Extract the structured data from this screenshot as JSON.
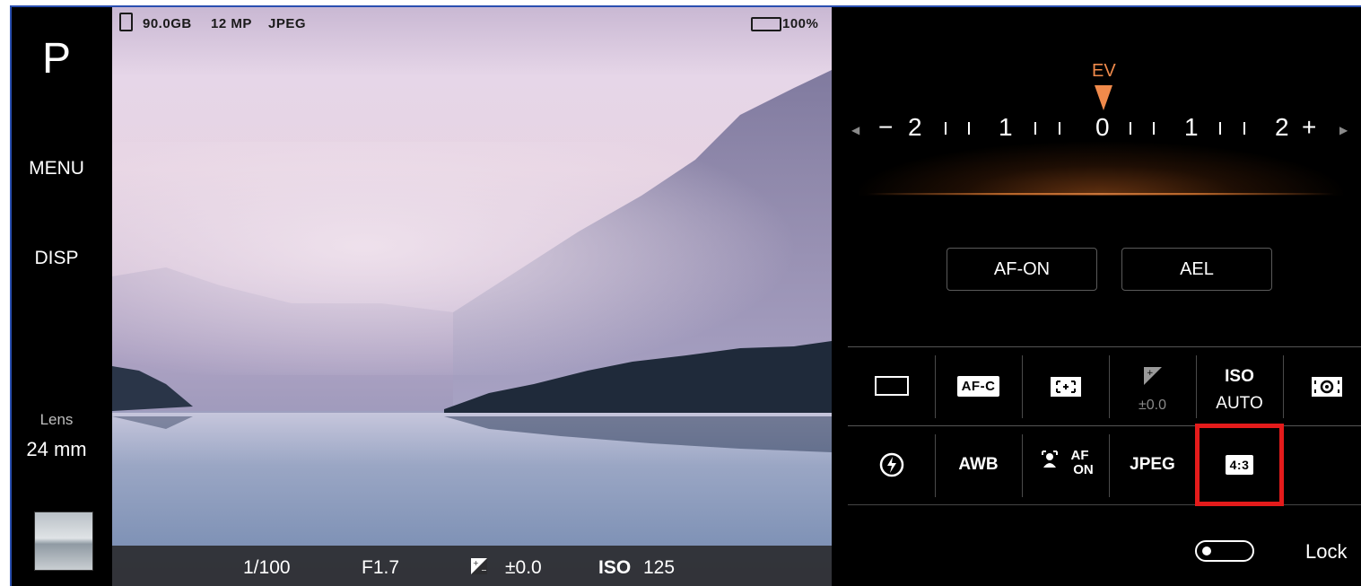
{
  "left_rail": {
    "mode": "P",
    "menu_label": "MENU",
    "disp_label": "DISP",
    "lens_caption": "Lens",
    "lens_value": "24 mm"
  },
  "status": {
    "storage": "90.0GB",
    "megapixels": "12 MP",
    "format": "JPEG",
    "battery": "100%"
  },
  "bottom_bar": {
    "shutter": "1/100",
    "aperture": "F1.7",
    "ev": "±0.0",
    "iso_label": "ISO",
    "iso_value": "125"
  },
  "ev_dial": {
    "label": "EV",
    "minus": "−",
    "plus": "+",
    "scale": [
      "2",
      "1",
      "0",
      "1",
      "2"
    ],
    "current": "0"
  },
  "buttons": {
    "af_on": "AF-ON",
    "ael": "AEL"
  },
  "quick_settings": {
    "row1": {
      "drive_icon": "single-shot-icon",
      "focus_mode": "AF-C",
      "focus_area_icon": "focus-area-icon",
      "ev_value": "±0.0",
      "iso_label": "ISO",
      "iso_value": "AUTO",
      "metering_icon": "metering-icon"
    },
    "row2": {
      "flash_icon": "flash-auto-icon",
      "white_balance": "AWB",
      "face_af_label": "AF",
      "face_af_sub": "ON",
      "file_format": "JPEG",
      "aspect_ratio": "4:3"
    }
  },
  "lock": {
    "label": "Lock",
    "enabled": false
  },
  "colors": {
    "accent_orange": "#f08a4b",
    "highlight_red": "#e41b1b"
  }
}
